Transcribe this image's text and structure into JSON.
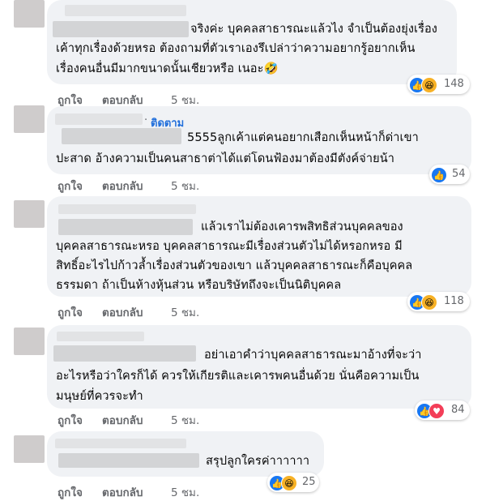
{
  "comments": [
    {
      "lines": [
        "จริงค่ะ บุคคลสาธารณะแล้วไง จำเป็นต้องยุ่งเรื่อง",
        "เค้าทุกเรื่องด้วยหรอ ต้องถามที่ตัวเราเองรึเปล่าว่าความอยากรู้อยากเห็น",
        "เรื่องคนอื่นมีมากขนาดนั้นเชียวหรือ เนอะ🤣"
      ],
      "like": "ถูกใจ",
      "reply": "ตอบกลับ",
      "time": "5 ชม.",
      "count": "148"
    },
    {
      "follow": "ติดตาม",
      "lines": [
        "5555ลูกเค้าแต่คนอยากเสือกเห็นหน้าก็ด่าเขา",
        "ปะสาด อ้างความเป็นคนสาธาต่าได้แต่โดนฟ้องมาต้องมีตังค์จ่ายน้า"
      ],
      "like": "ถูกใจ",
      "reply": "ตอบกลับ",
      "time": "5 ชม.",
      "count": "54"
    },
    {
      "lines": [
        "แล้วเราไม่ต้องเคารพสิทธิส่วนบุคคลของ",
        "บุคคลสาธารณะหรอ บุคคลสาธารณะมีเรื่องส่วนตัวไม่ได้หรอกหรอ มี",
        "สิทธิ์อะไรไปก้าวล้ำเรื่องส่วนตัวของเขา แล้วบุคคลสาธารณะก็คือบุคคล",
        "ธรรมดา ถ้าเป็นห้างหุ้นส่วน หรือบริษัทถึงจะเป็นนิติบุคคล"
      ],
      "like": "ถูกใจ",
      "reply": "ตอบกลับ",
      "time": "5 ชม.",
      "count": "118"
    },
    {
      "lines": [
        "อย่าเอาคำว่าบุคคลสาธารณะมาอ้างที่จะว่า",
        "อะไรหรือว่าใครก็ได้ ควรให้เกียรติและเคารพคนอื่นด้วย นั่นคือความเป็น",
        "มนุษย์ที่ควรจะทำ"
      ],
      "like": "ถูกใจ",
      "reply": "ตอบกลับ",
      "time": "5 ชม.",
      "count": "84"
    },
    {
      "lines": [
        "สรุปลูกใครค่าาาาาา"
      ],
      "like": "ถูกใจ",
      "reply": "ตอบกลับ",
      "time": "5 ชม.",
      "count": "25"
    }
  ],
  "icons": {
    "like": "thumbs-up-icon",
    "haha": "laughing-face-icon",
    "love": "heart-icon"
  },
  "colors": {
    "bubble": "#f0f2f5",
    "like_blue": "#1877f2",
    "haha_yellow": "#f7b125",
    "love_red": "#f33e58",
    "follow_blue": "#216fdb",
    "meta_gray": "#65676b"
  }
}
